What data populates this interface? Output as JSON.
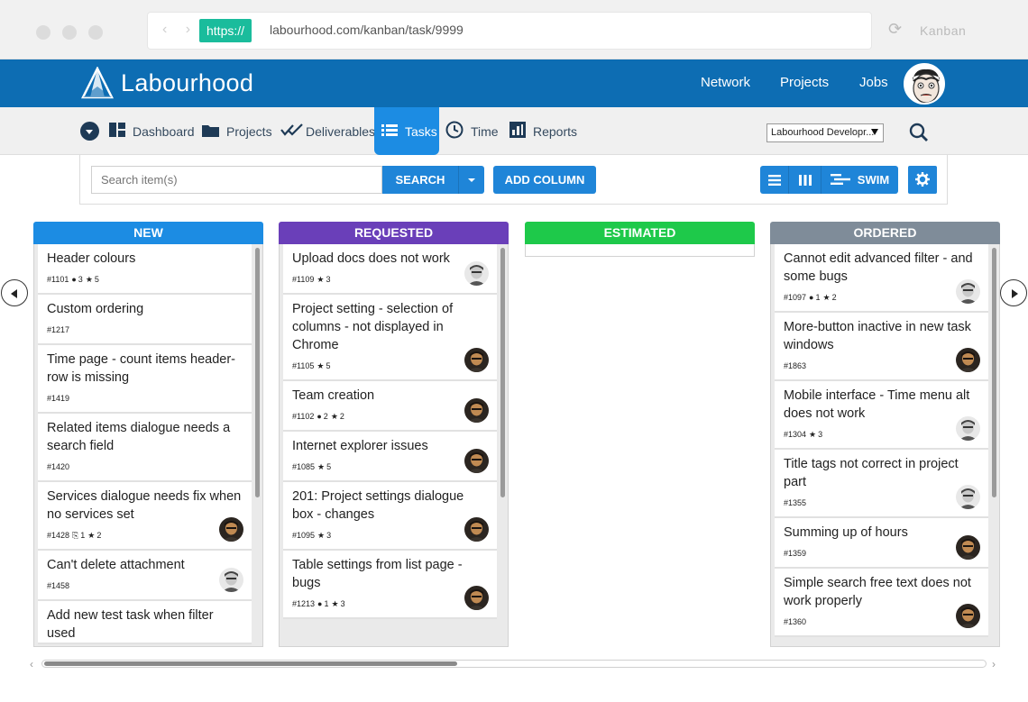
{
  "browser": {
    "https_label": "https://",
    "url": "labourhood.com/kanban/task/9999",
    "tab_title": "Kanban"
  },
  "header": {
    "brand": "Labourhood",
    "nav": [
      "Network",
      "Projects",
      "Jobs"
    ]
  },
  "subnav": {
    "items": [
      {
        "label": "Dashboard",
        "icon": "dashboard-icon"
      },
      {
        "label": "Projects",
        "icon": "folder-icon"
      },
      {
        "label": "Deliverables",
        "icon": "double-check-icon"
      },
      {
        "label": "Tasks",
        "icon": "list-icon",
        "active": true
      },
      {
        "label": "Time",
        "icon": "clock-icon"
      },
      {
        "label": "Reports",
        "icon": "bar-chart-icon"
      }
    ],
    "workspace": "Labourhood Developr..."
  },
  "toolbar": {
    "search_placeholder": "Search item(s)",
    "search_label": "SEARCH",
    "add_column_label": "ADD COLUMN",
    "swim_label": "SWIM"
  },
  "colors": {
    "brand": "#0d6db3",
    "new": "#1c8ce3",
    "requested": "#6a3fb9",
    "estimated": "#1ec94a",
    "ordered": "#7f8c99"
  },
  "columns": [
    {
      "title": "NEW",
      "cards": [
        {
          "title": "Header colours",
          "meta": "#1101",
          "comments": "3",
          "pins": "5",
          "avatar": ""
        },
        {
          "title": "Custom ordering",
          "meta": "#1217",
          "avatar": ""
        },
        {
          "title": "Time page - count items header-row is missing",
          "meta": "#1419",
          "avatar": ""
        },
        {
          "title": "Related items dialogue needs a search field",
          "meta": "#1420",
          "avatar": ""
        },
        {
          "title": "Services dialogue needs fix when no services set",
          "meta": "#1428",
          "attachments": "1",
          "pins": "2",
          "avatar": "dark"
        },
        {
          "title": "Can't delete attachment",
          "meta": "#1458",
          "avatar": "light"
        },
        {
          "title": "Add new test task when filter used",
          "meta": "",
          "avatar": ""
        }
      ]
    },
    {
      "title": "REQUESTED",
      "cards": [
        {
          "title": "Upload docs does not work",
          "meta": "#1109",
          "pins": "3",
          "avatar": "light"
        },
        {
          "title": "Project setting - selection of columns - not displayed in Chrome",
          "meta": "#1105",
          "pins": "5",
          "avatar": "dark"
        },
        {
          "title": "Team creation",
          "meta": "#1102",
          "comments": "2",
          "pins": "2",
          "avatar": "dark"
        },
        {
          "title": "Internet explorer issues",
          "meta": "#1085",
          "pins": "5",
          "avatar": "dark"
        },
        {
          "title": "201: Project settings dialogue box - changes",
          "meta": "#1095",
          "pins": "3",
          "avatar": "dark"
        },
        {
          "title": "Table settings from list page - bugs",
          "meta": "#1213",
          "comments": "1",
          "pins": "3",
          "avatar": "dark"
        }
      ]
    },
    {
      "title": "ESTIMATED",
      "cards": []
    },
    {
      "title": "ORDERED",
      "cards": [
        {
          "title": "Cannot edit advanced filter - and some bugs",
          "meta": "#1097",
          "comments": "1",
          "pins": "2",
          "avatar": "light"
        },
        {
          "title": "More-button inactive in new task windows",
          "meta": "#1863",
          "avatar": "dark"
        },
        {
          "title": "Mobile interface - Time menu alt does not work",
          "meta": "#1304",
          "pins": "3",
          "avatar": "light"
        },
        {
          "title": "Title tags not correct in project part",
          "meta": "#1355",
          "avatar": "light"
        },
        {
          "title": "Summing up of hours",
          "meta": "#1359",
          "avatar": "dark"
        },
        {
          "title": "Simple search free text does not work properly",
          "meta": "#1360",
          "avatar": "dark"
        }
      ]
    }
  ]
}
